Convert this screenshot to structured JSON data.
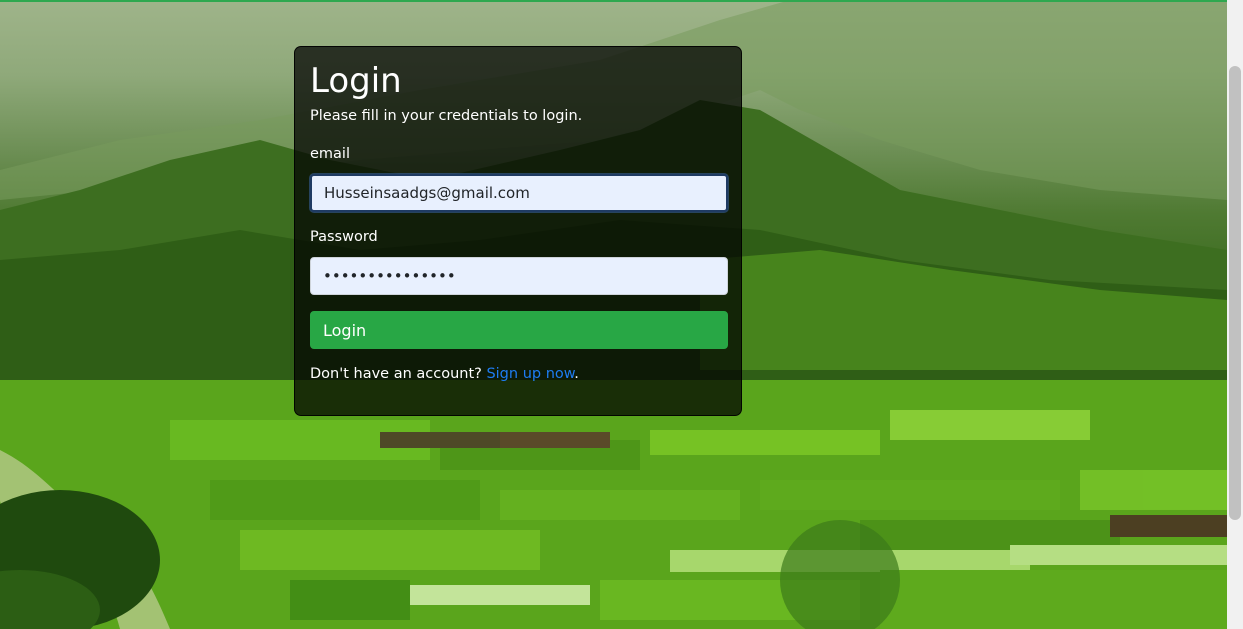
{
  "login": {
    "title": "Login",
    "subtitle": "Please fill in your credentials to login.",
    "email_label": "email",
    "email_value": "Husseinsaadgs@gmail.com",
    "password_label": "Password",
    "password_value": "•••••••••••••••",
    "submit_label": "Login",
    "signup_prompt": "Don't have an account?",
    "signup_link": "Sign up now",
    "signup_suffix": "."
  },
  "colors": {
    "accent": "#28a745",
    "link": "#1e7cf2",
    "input_bg": "#e8f0fe"
  }
}
